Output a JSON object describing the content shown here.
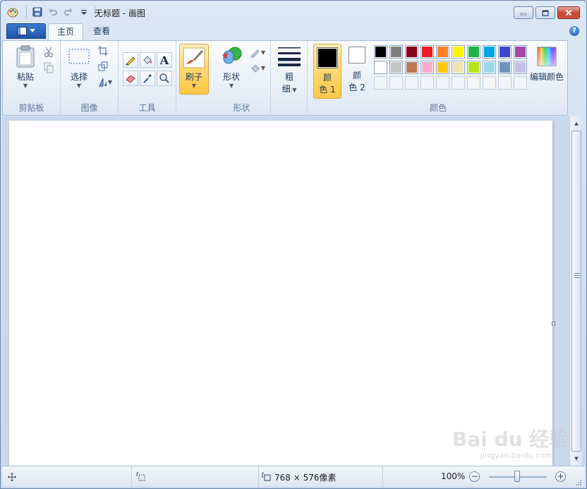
{
  "window": {
    "title": "无标题 - 画图"
  },
  "tabs": [
    {
      "label": "主页",
      "active": true
    },
    {
      "label": "查看",
      "active": false
    }
  ],
  "clipboard": {
    "paste_label": "粘贴",
    "group_label": "剪贴板"
  },
  "image": {
    "select_label": "选择",
    "group_label": "图像"
  },
  "tools": {
    "group_label": "工具",
    "text_tool_glyph": "A"
  },
  "brushes": {
    "label": "刷子"
  },
  "shapes": {
    "label": "形状",
    "group_label": "形状"
  },
  "size": {
    "label_line1": "粗",
    "label_line2": "细"
  },
  "colors": {
    "group_label": "颜色",
    "color1_line1": "颜",
    "color1_line2": "色 1",
    "color2_line1": "颜",
    "color2_line2": "色 2",
    "edit_label": "编辑颜色",
    "color1_value": "#000000",
    "color2_value": "#ffffff",
    "palette_row1": [
      "#000000",
      "#7f7f7f",
      "#880015",
      "#ed1c24",
      "#ff7f27",
      "#fff200",
      "#22b14c",
      "#00a2e8",
      "#3f48cc",
      "#a349a4"
    ],
    "palette_row2": [
      "#ffffff",
      "#c3c3c3",
      "#b97a57",
      "#ffaec9",
      "#ffc90e",
      "#efe4b0",
      "#b5e61d",
      "#99d9ea",
      "#7092be",
      "#c8bfe7"
    ]
  },
  "status": {
    "dimensions": "768 × 576像素",
    "zoom": "100%"
  },
  "watermark": {
    "brand": "Bai du 经验",
    "url": "jingyan.baidu.com"
  }
}
